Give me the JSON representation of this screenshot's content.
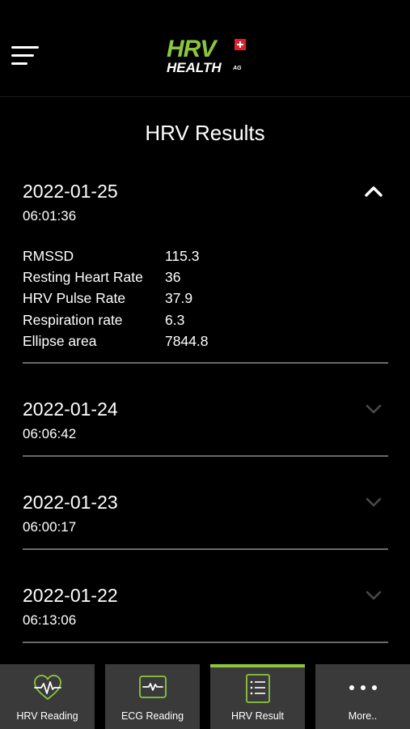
{
  "header": {
    "logo_hrv": "HRV",
    "logo_health": "HEALTH",
    "logo_ag": "AG",
    "brand_color": "#8cc63f"
  },
  "page": {
    "title": "HRV Results"
  },
  "results": [
    {
      "date": "2022-01-25",
      "time": "06:01:36",
      "expanded": true,
      "metrics": [
        {
          "label": "RMSSD",
          "value": "115.3"
        },
        {
          "label": "Resting Heart Rate",
          "value": "36"
        },
        {
          "label": "HRV Pulse Rate",
          "value": "37.9"
        },
        {
          "label": "Respiration rate",
          "value": "6.3"
        },
        {
          "label": "Ellipse area",
          "value": "7844.8"
        }
      ]
    },
    {
      "date": "2022-01-24",
      "time": "06:06:42",
      "expanded": false
    },
    {
      "date": "2022-01-23",
      "time": "06:00:17",
      "expanded": false
    },
    {
      "date": "2022-01-22",
      "time": "06:13:06",
      "expanded": false
    }
  ],
  "tabs": [
    {
      "label": "HRV Reading",
      "icon": "heart-pulse-icon"
    },
    {
      "label": "ECG Reading",
      "icon": "ecg-monitor-icon"
    },
    {
      "label": "HRV Result",
      "icon": "list-icon",
      "active": true
    },
    {
      "label": "More..",
      "icon": "more-dots-icon"
    }
  ]
}
